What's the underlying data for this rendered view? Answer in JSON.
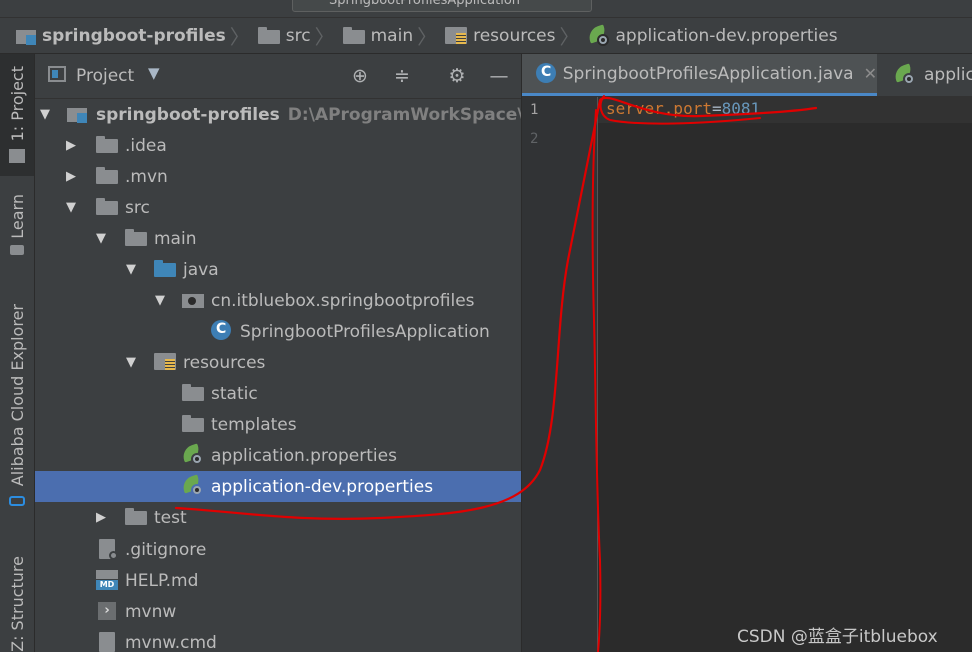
{
  "toolbar": {
    "run_config_label": "SpringbootProfilesApplication"
  },
  "breadcrumb": [
    {
      "label": "springboot-profiles",
      "icon": "module-icon"
    },
    {
      "label": "src",
      "icon": "folder-icon"
    },
    {
      "label": "main",
      "icon": "folder-icon"
    },
    {
      "label": "resources",
      "icon": "resources-folder-icon"
    },
    {
      "label": "application-dev.properties",
      "icon": "spring-properties-icon"
    }
  ],
  "left_stripe": {
    "project": "1: Project",
    "learn": "Learn",
    "alibaba": "Alibaba Cloud Explorer",
    "structure": "Z: Structure"
  },
  "project_panel": {
    "title": "Project",
    "tree": [
      {
        "label": "springboot-profiles",
        "path": "D:\\AProgramWorkSpace\\idea\\s",
        "icon": "module-icon",
        "expanded": true
      },
      {
        "label": ".idea",
        "icon": "folder-icon",
        "expanded": false
      },
      {
        "label": ".mvn",
        "icon": "folder-icon",
        "expanded": false
      },
      {
        "label": "src",
        "icon": "folder-icon",
        "expanded": true
      },
      {
        "label": "main",
        "icon": "folder-icon",
        "expanded": true
      },
      {
        "label": "java",
        "icon": "source-folder-icon",
        "expanded": true
      },
      {
        "label": "cn.itbluebox.springbootprofiles",
        "icon": "package-icon",
        "expanded": true
      },
      {
        "label": "SpringbootProfilesApplication",
        "icon": "spring-class-icon"
      },
      {
        "label": "resources",
        "icon": "resources-folder-icon",
        "expanded": true
      },
      {
        "label": "static",
        "icon": "folder-icon"
      },
      {
        "label": "templates",
        "icon": "folder-icon"
      },
      {
        "label": "application.properties",
        "icon": "spring-properties-icon"
      },
      {
        "label": "application-dev.properties",
        "icon": "spring-properties-icon",
        "selected": true
      },
      {
        "label": "test",
        "icon": "folder-icon",
        "expanded": false
      },
      {
        "label": ".gitignore",
        "icon": "gitignore-file-icon"
      },
      {
        "label": "HELP.md",
        "icon": "markdown-file-icon"
      },
      {
        "label": "mvnw",
        "icon": "shell-file-icon"
      },
      {
        "label": "mvnw.cmd",
        "icon": "cmd-file-icon"
      }
    ]
  },
  "editor": {
    "tabs": [
      {
        "label": "SpringbootProfilesApplication.java",
        "active": true
      },
      {
        "label": "applic"
      }
    ],
    "line_numbers": [
      "1",
      "2"
    ],
    "code": {
      "key": "server.port",
      "op": "=",
      "value": "8081"
    }
  },
  "watermark": "CSDN @蓝盒子itbluebox",
  "colors": {
    "selection": "#4b6eaf",
    "annotation": "#e00000",
    "keyword": "#cc7832",
    "number": "#6897bb"
  }
}
